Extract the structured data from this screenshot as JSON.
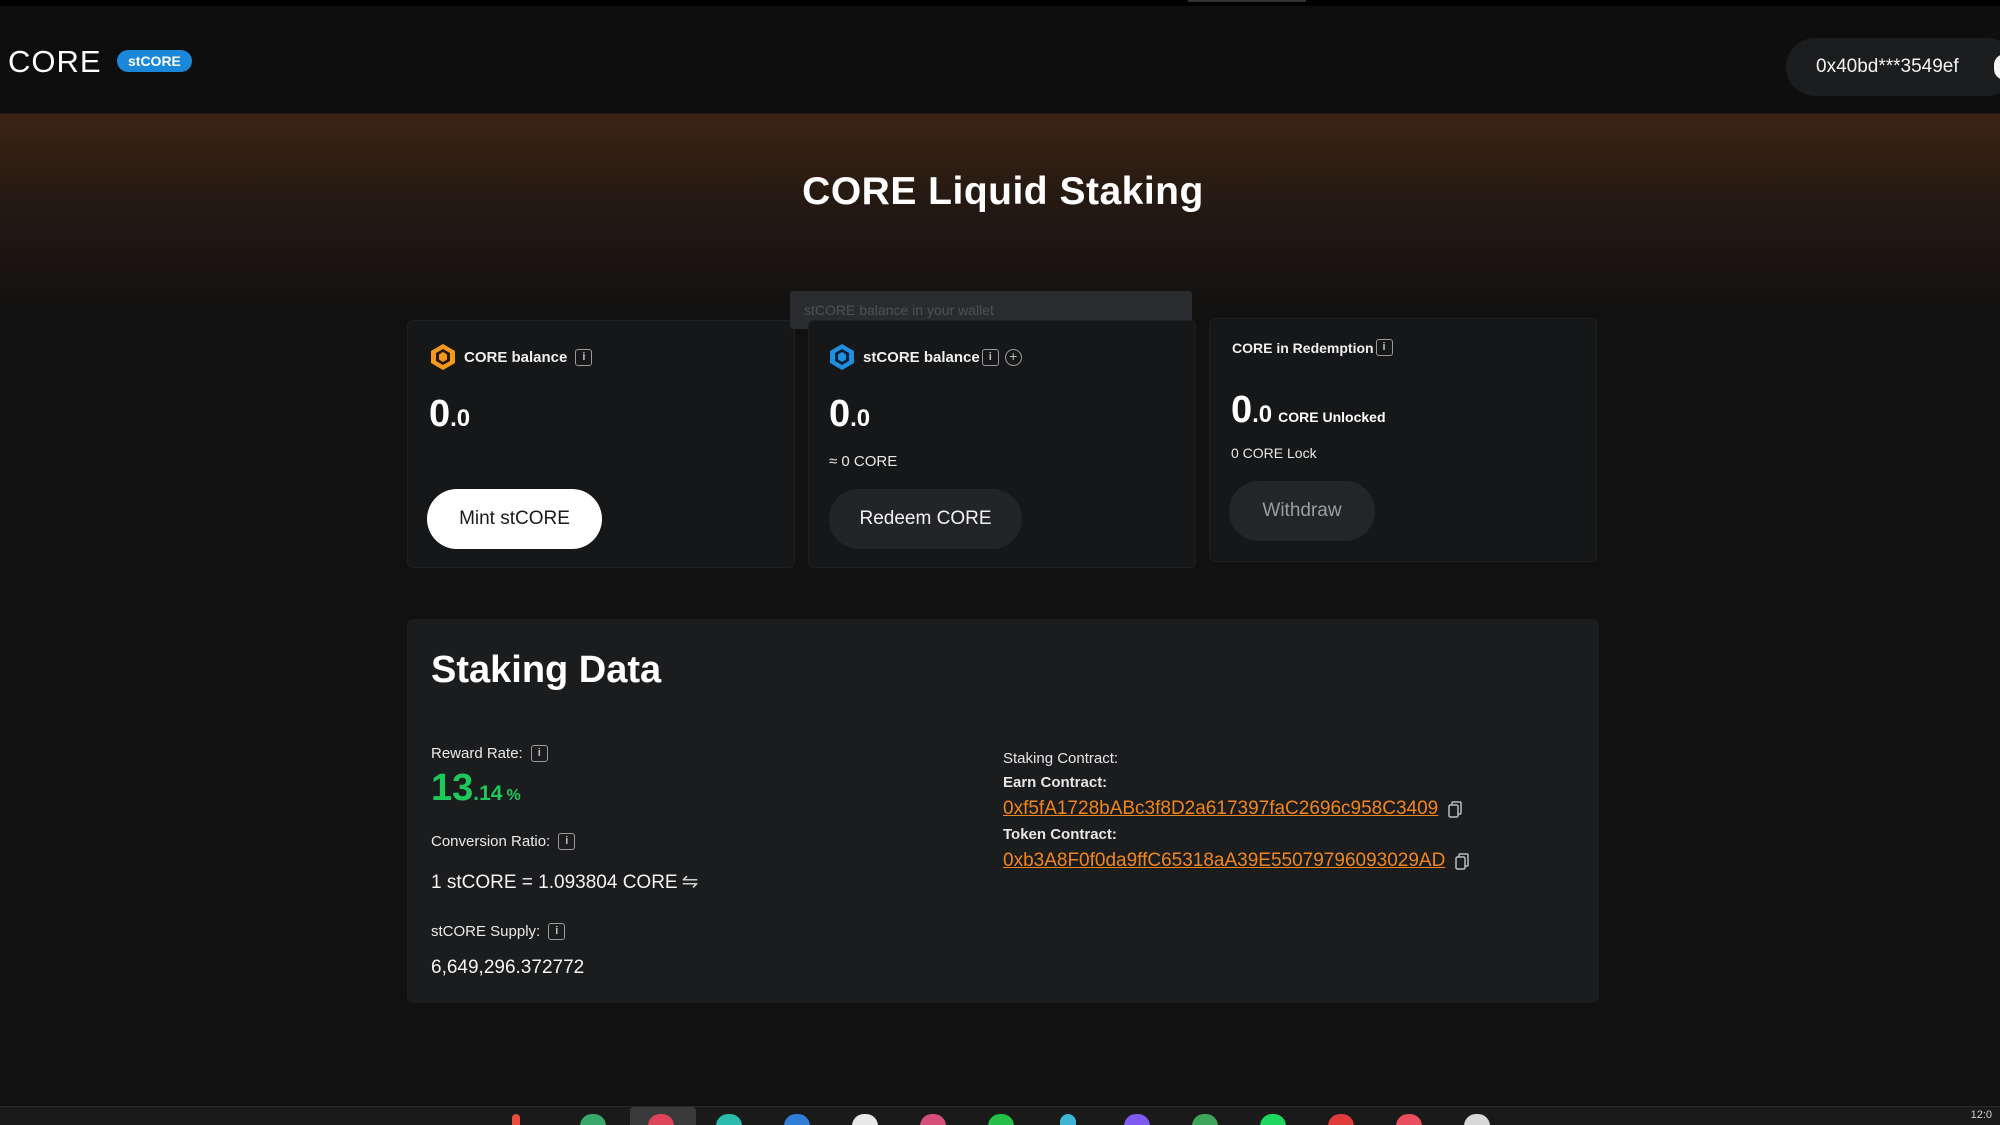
{
  "header": {
    "logo": "CORE",
    "badge": "stCORE",
    "wallet_address": "0x40bd***3549ef"
  },
  "page_title": "CORE Liquid Staking",
  "tooltip": "stCORE balance in your wallet",
  "cards": {
    "core_balance": {
      "label": "CORE balance",
      "icon": "core-coin-icon",
      "value_int": "0",
      "value_dec": ".0",
      "button": "Mint stCORE"
    },
    "stcore_balance": {
      "label": "stCORE balance",
      "icon": "stcore-coin-icon",
      "value_int": "0",
      "value_dec": ".0",
      "approx": "≈ 0 CORE",
      "button": "Redeem CORE"
    },
    "redemption": {
      "label": "CORE in Redemption",
      "value_int": "0",
      "value_dec": ".0",
      "unit": "CORE Unlocked",
      "lock": "0  CORE Lock",
      "button": "Withdraw"
    }
  },
  "staking_data": {
    "title": "Staking Data",
    "reward_rate_label": "Reward Rate:",
    "reward_rate_int": "13",
    "reward_rate_dec": ".14",
    "reward_rate_unit": "%",
    "conversion_label": "Conversion Ratio:",
    "conversion_value": "1 stCORE = 1.093804 CORE",
    "supply_label": "stCORE Supply:",
    "supply_value": "6,649,296.372772",
    "staking_contract_label": "Staking Contract:",
    "earn_contract_label": "Earn Contract:",
    "earn_contract": "0xf5fA1728bABc3f8D2a617397faC2696c958C3409",
    "token_contract_label": "Token Contract:",
    "token_contract": "0xb3A8F0f0da9ffC65318aA39E55079796093029AD"
  },
  "colors": {
    "accent_green": "#1fc85a",
    "link_orange": "#f2861c",
    "badge_blue": "#1a87d9",
    "core_orange": "#f39a1e"
  },
  "taskbar": {
    "clock": "12:0"
  }
}
